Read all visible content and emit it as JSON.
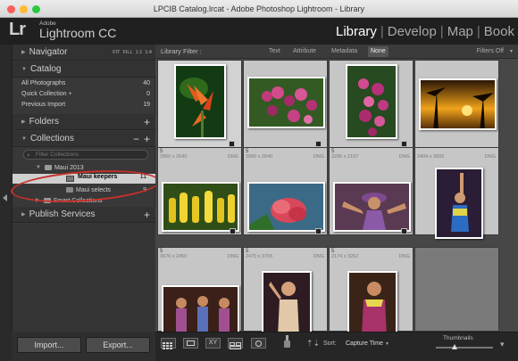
{
  "window": {
    "title": "LPCIB Catalog.lrcat - Adobe Photoshop Lightroom - Library"
  },
  "app": {
    "logo": "Lr",
    "vendor": "Adobe",
    "name": "Lightroom CC"
  },
  "modules": [
    {
      "label": "Library",
      "active": true
    },
    {
      "label": "Develop"
    },
    {
      "label": "Map"
    },
    {
      "label": "Book"
    }
  ],
  "navigator": {
    "label": "Navigator",
    "zoom_options": [
      "FIT",
      "FILL",
      "1:1",
      "1:4"
    ]
  },
  "catalog": {
    "label": "Catalog",
    "items": [
      {
        "label": "All Photographs",
        "count": "40"
      },
      {
        "label": "Quick Collection +",
        "count": "0"
      },
      {
        "label": "Previous Import",
        "count": "19"
      }
    ]
  },
  "folders": {
    "label": "Folders",
    "add": "+"
  },
  "collections": {
    "label": "Collections",
    "remove": "−",
    "add": "+",
    "filter_placeholder": "Filter Collections",
    "set": "Maui 2013",
    "items": [
      {
        "label": "Maui keepers",
        "count": "11",
        "selected": true
      },
      {
        "label": "Maui selects",
        "count": "9"
      }
    ],
    "smart": "Smart Collections"
  },
  "publish": {
    "label": "Publish Services",
    "add": "+"
  },
  "buttons": {
    "import": "Import...",
    "export": "Export..."
  },
  "library_filter": {
    "label": "Library Filter :",
    "options": [
      "Text",
      "Attribute",
      "Metadata",
      "None"
    ],
    "active": "None",
    "preset": "Filters Off"
  },
  "grid": [
    {
      "index": "",
      "dims": "",
      "ext": "",
      "selected": true
    },
    {
      "index": "",
      "dims": "",
      "ext": ""
    },
    {
      "index": "",
      "dims": "",
      "ext": ""
    },
    {
      "index": "",
      "dims": "",
      "ext": ""
    },
    {
      "index": "5",
      "dims": "3960 x 2640",
      "ext": "DNG"
    },
    {
      "index": "5",
      "dims": "3960 x 2640",
      "ext": "DNG"
    },
    {
      "index": "5",
      "dims": "3296 x 2197",
      "ext": "DNG"
    },
    {
      "index": "",
      "dims": "2404 x 3606",
      "ext": "DNG"
    },
    {
      "index": "5",
      "dims": "3676 x 2450",
      "ext": "DNG"
    },
    {
      "index": "5",
      "dims": "2470 x 3705",
      "ext": "DNG"
    },
    {
      "index": "5",
      "dims": "2174 x 3262",
      "ext": "DNG"
    }
  ],
  "toolbar": {
    "sort_label": "Sort:",
    "sort_value": "Capture Time",
    "thumbnails_label": "Thumbnails"
  }
}
